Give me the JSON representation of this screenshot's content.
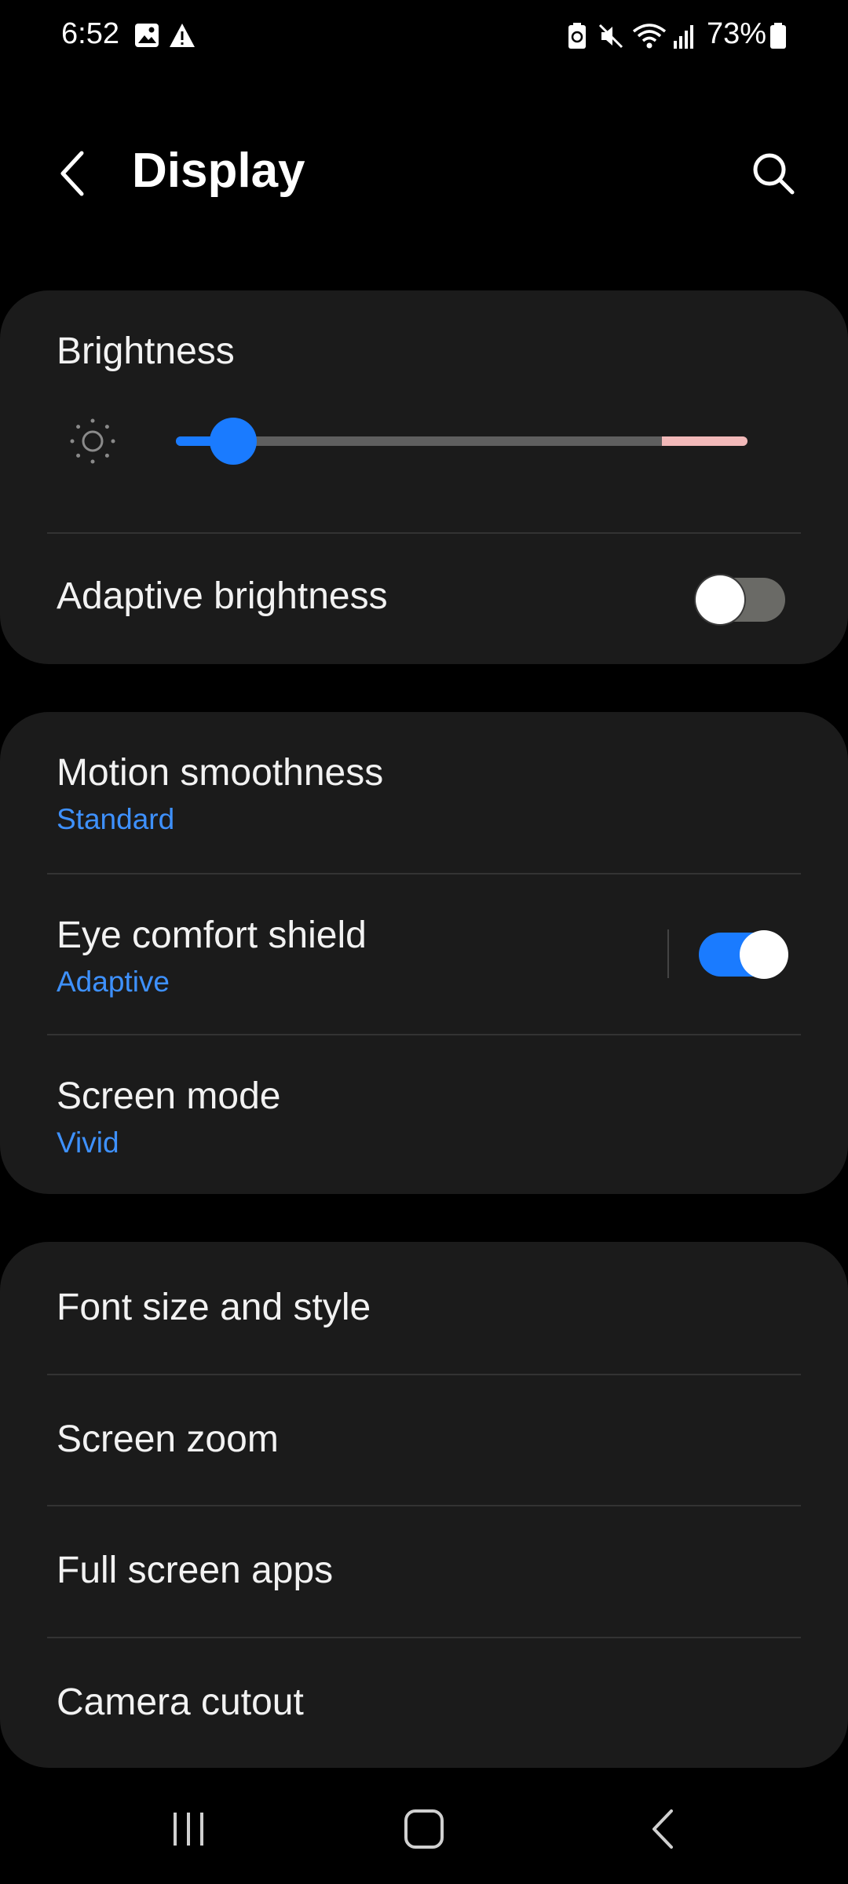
{
  "status_bar": {
    "time": "6:52",
    "battery_percent": "73%",
    "icons": [
      "image-icon",
      "warning-icon",
      "battery-saver-icon",
      "mute-icon",
      "wifi-icon",
      "signal-icon",
      "battery-icon"
    ]
  },
  "header": {
    "title": "Display",
    "icons": [
      "back-arrow-icon",
      "search-icon"
    ]
  },
  "brightness": {
    "label": "Brightness",
    "level": 0.1,
    "extra_brightness_start": 0.85,
    "icon": "sun-icon"
  },
  "adaptive_brightness": {
    "label": "Adaptive brightness",
    "enabled": false
  },
  "motion_smoothness": {
    "label": "Motion smoothness",
    "value": "Standard"
  },
  "eye_comfort_shield": {
    "label": "Eye comfort shield",
    "value": "Adaptive",
    "enabled": true
  },
  "screen_mode": {
    "label": "Screen mode",
    "value": "Vivid"
  },
  "menu_items": [
    {
      "label": "Font size and style"
    },
    {
      "label": "Screen zoom"
    },
    {
      "label": "Full screen apps"
    },
    {
      "label": "Camera cutout"
    }
  ],
  "nav_bar": {
    "icons": [
      "recent-apps-icon",
      "home-icon",
      "back-icon"
    ]
  },
  "colors": {
    "accent": "#1a7bff",
    "subtext": "#3e91ff",
    "card": "#1b1b1b",
    "background": "#000000"
  }
}
